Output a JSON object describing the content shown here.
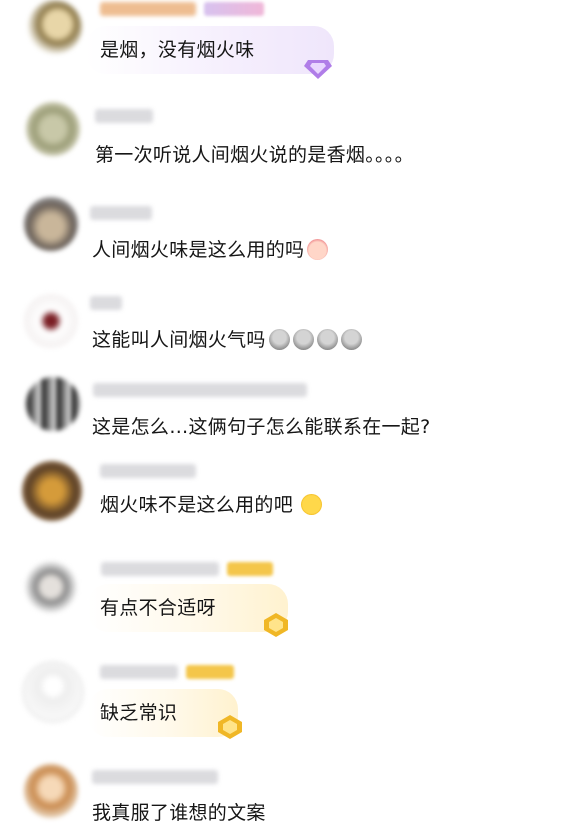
{
  "comments": [
    {
      "text": "是烟，没有烟火味",
      "emoji": []
    },
    {
      "text": "第一次听说人间烟火说的是香烟。。。。",
      "emoji": []
    },
    {
      "text": "人间烟火味是这么用的吗",
      "emoji": [
        "crying-baby-emoji"
      ]
    },
    {
      "text": "这能叫人间烟火气吗",
      "emoji": [
        "rock-face-emoji",
        "rock-face-emoji",
        "rock-face-emoji",
        "rock-face-emoji"
      ]
    },
    {
      "text": "这是怎么…这俩句子怎么能联系在一起?",
      "emoji": []
    },
    {
      "text": "烟火味不是这么用的吧",
      "emoji": [
        "laugh-cry-emoji"
      ]
    },
    {
      "text": "有点不合适呀",
      "emoji": []
    },
    {
      "text": "缺乏常识",
      "emoji": []
    },
    {
      "text": "我真服了谁想的文案",
      "emoji": []
    }
  ],
  "colors": {
    "purple_bubble": "#f3eefc",
    "gold_bubble": "#fff8e6",
    "gold_badge": "#f5c542",
    "purple_badge": "#c9a8f0"
  }
}
